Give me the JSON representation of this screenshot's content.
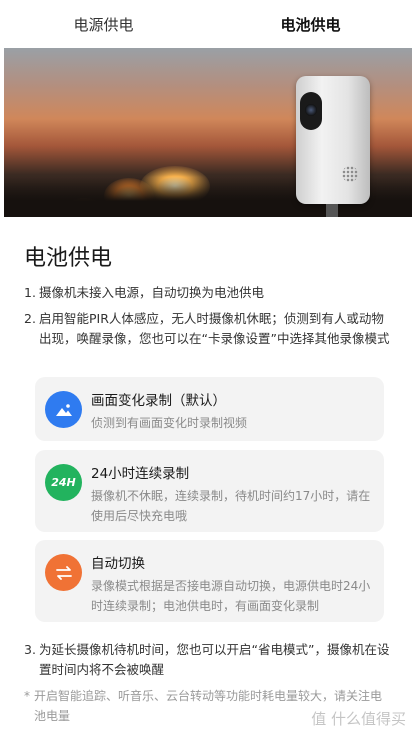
{
  "tabs": [
    {
      "label": "电源供电",
      "active": false
    },
    {
      "label": "电池供电",
      "active": true
    }
  ],
  "colors": {
    "accent": "#2f7bf0",
    "green": "#22b35e",
    "orange": "#f07235",
    "card_bg": "#f3f3f3"
  },
  "section_title": "电池供电",
  "notes": [
    {
      "num": "1.",
      "text": "摄像机未接入电源，自动切换为电池供电"
    },
    {
      "num": "2.",
      "text": "启用智能PIR人体感应，无人时摄像机休眠；侦测到有人或动物出现，唤醒录像，您也可以在“卡录像设置”中选择其他录像模式"
    },
    {
      "num": "3.",
      "text": "为延长摄像机待机时间，您也可以开启“省电模式”，摄像机在设置时间内将不会被唤醒"
    }
  ],
  "modes": [
    {
      "icon": "image-icon",
      "icon_text": "",
      "title": "画面变化录制（默认）",
      "desc": "侦测到有画面变化时录制视频"
    },
    {
      "icon": "24h-icon",
      "icon_text": "24H",
      "title": "24小时连续录制",
      "desc": "摄像机不休眠，连续录制，待机时间约17小时，请在使用后尽快充电哦"
    },
    {
      "icon": "switch-icon",
      "icon_text": "",
      "title": "自动切换",
      "desc": "录像模式根据是否接电源自动切换，电源供电时24小时连续录制；电池供电时，有画面变化录制"
    }
  ],
  "footnote": {
    "star": "*",
    "text": "开启智能追踪、听音乐、云台转动等功能时耗电量较大，请关注电池电量"
  },
  "watermark": "值 什么值得买"
}
